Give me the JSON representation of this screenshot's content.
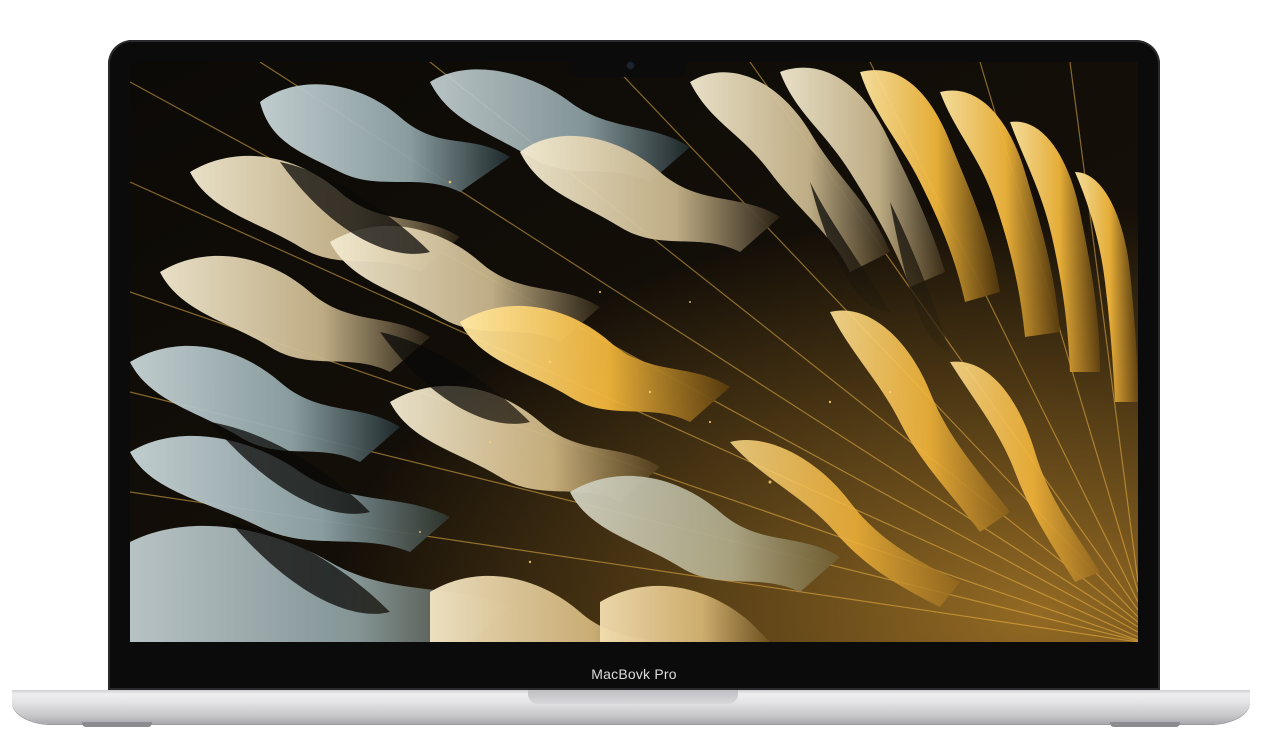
{
  "device": {
    "brand_label": "MacBovk Pro"
  },
  "wallpaper": {
    "description_colors": {
      "gold": "#f2b63a",
      "cream": "#efe4c2",
      "teal": "#aebfc2",
      "dark": "#0b0a08"
    }
  }
}
